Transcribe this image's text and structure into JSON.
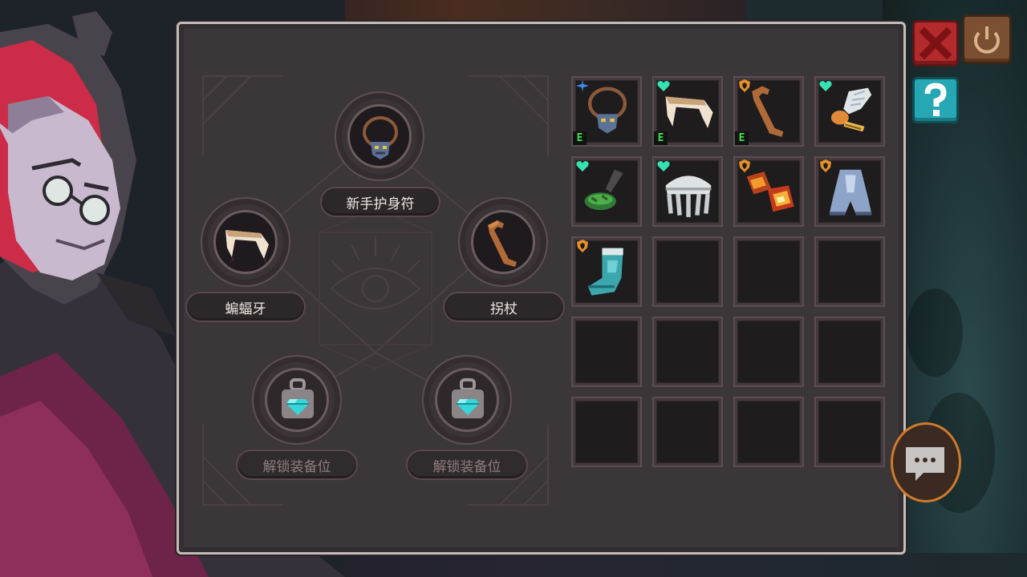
{
  "equipment": {
    "slots": [
      {
        "id": "amulet",
        "label": "新手护身符",
        "icon": "amulet-icon",
        "locked": false
      },
      {
        "id": "fang",
        "label": "蝙蝠牙",
        "icon": "bat-fang-icon",
        "locked": false
      },
      {
        "id": "cane",
        "label": "拐杖",
        "icon": "cane-icon",
        "locked": false
      },
      {
        "id": "lock1",
        "label": "解锁装备位",
        "icon": "gem-lock-icon",
        "locked": true
      },
      {
        "id": "lock2",
        "label": "解锁装备位",
        "icon": "gem-lock-icon",
        "locked": true
      }
    ]
  },
  "inventory": {
    "columns": 4,
    "rows": 5,
    "equipped_tag": "E",
    "items": [
      {
        "icon": "amulet-icon",
        "badge": "blue-star-badge",
        "equipped": true
      },
      {
        "icon": "bat-fang-icon",
        "badge": "green-heart-badge",
        "equipped": true
      },
      {
        "icon": "cane-icon",
        "badge": "orange-shield-badge",
        "equipped": true
      },
      {
        "icon": "feather-scroll-icon",
        "badge": "green-heart-badge",
        "equipped": false
      },
      {
        "icon": "frying-pan-icon",
        "badge": "green-heart-badge",
        "equipped": false
      },
      {
        "icon": "silver-crown-icon",
        "badge": "green-heart-badge",
        "equipped": false
      },
      {
        "icon": "fire-gauntlet-icon",
        "badge": "orange-shield-badge",
        "equipped": false
      },
      {
        "icon": "steel-boot-icon",
        "badge": "orange-shield-badge",
        "equipped": false
      },
      {
        "icon": "teal-sock-icon",
        "badge": "orange-shield-badge",
        "equipped": false
      }
    ]
  },
  "colors": {
    "panel_bg": "#3b3638",
    "panel_border": "#c4bcb6",
    "equipped_tag": "#43e04a",
    "heart_badge": "#35e3b0",
    "shield_badge": "#e7902a",
    "star_badge": "#3d8ff0",
    "close_button": "#b32a2c",
    "help_button": "#26a7b4"
  },
  "side_buttons": {
    "close_icon": "close-x-icon",
    "power_icon": "power-icon",
    "help_icon": "question-icon",
    "chat_icon": "chat-bubble-icon"
  }
}
